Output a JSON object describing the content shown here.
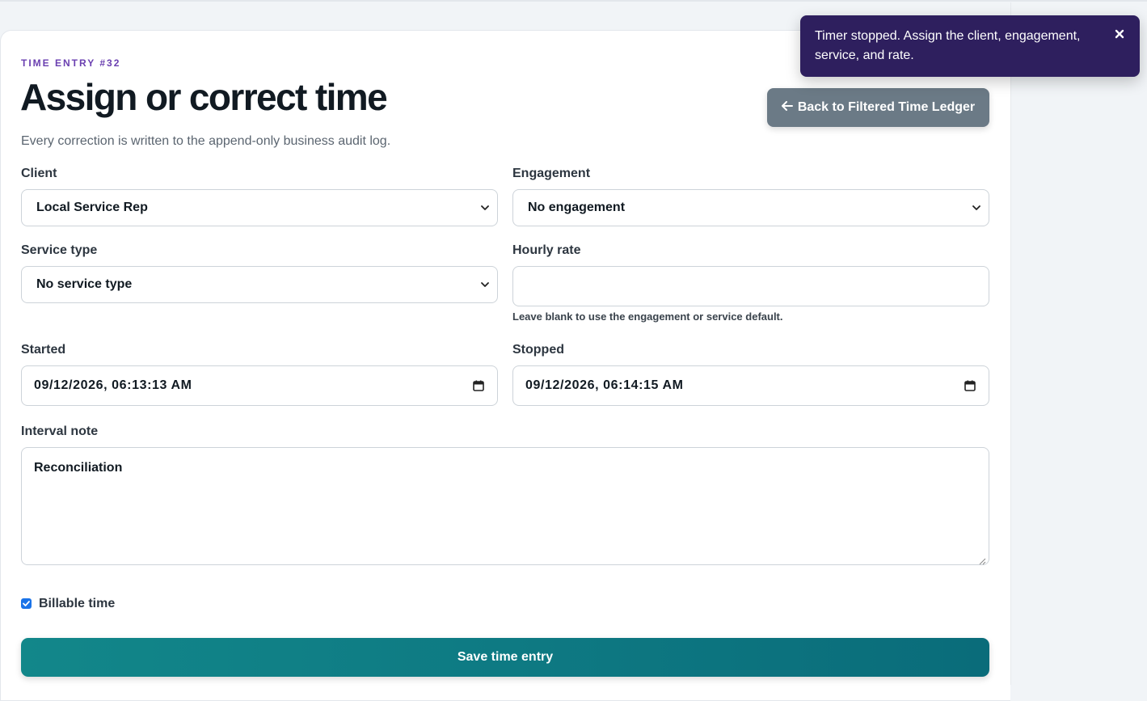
{
  "header": {
    "eyebrow": "TIME ENTRY #32",
    "title": "Assign or correct time",
    "subtitle": "Every correction is written to the append-only business audit log.",
    "back_label": "Back to Filtered Time Ledger"
  },
  "form": {
    "client": {
      "label": "Client",
      "value": "Local Service Rep"
    },
    "engagement": {
      "label": "Engagement",
      "value": "No engagement"
    },
    "service_type": {
      "label": "Service type",
      "value": "No service type"
    },
    "hourly_rate": {
      "label": "Hourly rate",
      "value": "",
      "hint": "Leave blank to use the engagement or service default."
    },
    "started": {
      "label": "Started",
      "value": "09/12/2026, 06:13:13 AM"
    },
    "stopped": {
      "label": "Stopped",
      "value": "09/12/2026, 06:14:15 AM"
    },
    "interval_note": {
      "label": "Interval note",
      "value": "Reconciliation"
    },
    "billable": {
      "label": "Billable time",
      "checked": true
    },
    "save_label": "Save time entry"
  },
  "toast": {
    "message": "Timer stopped. Assign the client, engagement, service, and rate."
  },
  "colors": {
    "accent": "#6a3fb0",
    "primary_button": "#0e7a83",
    "secondary_button": "#6b7a86",
    "toast_bg": "#2e1f5e",
    "checkbox": "#1a73e8"
  },
  "icons": {
    "back": "arrow-left-icon",
    "select": "chevron-down-icon",
    "date": "calendar-icon",
    "toast_close": "close-icon",
    "checkbox": "check-icon"
  }
}
